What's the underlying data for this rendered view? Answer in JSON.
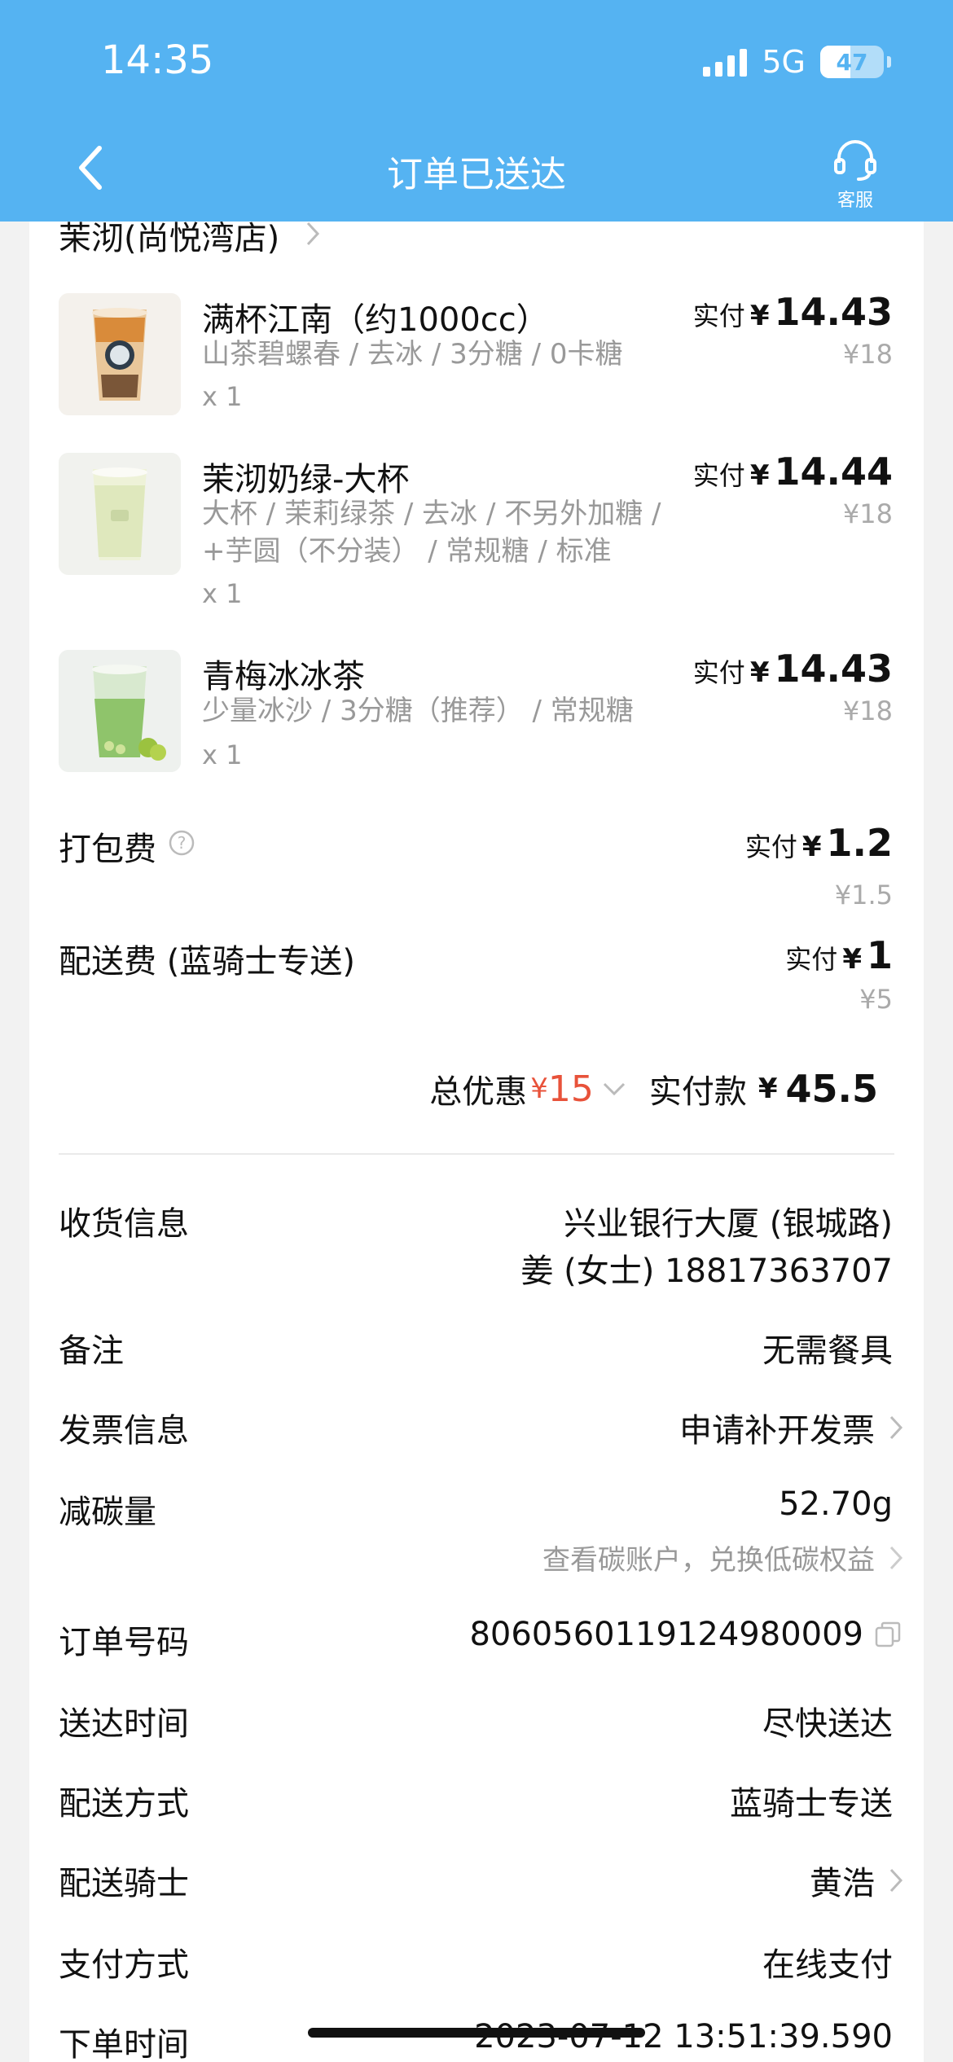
{
  "status_bar": {
    "time": "14:35",
    "network": "5G",
    "battery": "47",
    "battery_level": 0.47
  },
  "nav": {
    "back_icon": "chevron-left-icon",
    "title": "订单已送达",
    "service_label": "客服",
    "service_icon": "headset-icon"
  },
  "colors": {
    "header": "#55b3f2",
    "discount": "#e8523a",
    "muted": "#999999"
  },
  "store": {
    "name": "茉沏(尚悦湾店)"
  },
  "items": [
    {
      "name": "满杯江南（约1000cc）",
      "spec_lines": [
        "山茶碧螺春 / 去冰 / 3分糖 / 0卡糖"
      ],
      "qty": "x 1",
      "paid_label": "实付",
      "currency": "¥",
      "paid": "14.43",
      "original": "¥18"
    },
    {
      "name": "茉沏奶绿-大杯",
      "spec_lines": [
        "大杯 / 茉莉绿茶 / 去冰 / 不另外加糖 /",
        "+芋圆（不分装） / 常规糖 / 标准"
      ],
      "qty": "x 1",
      "paid_label": "实付",
      "currency": "¥",
      "paid": "14.44",
      "original": "¥18"
    },
    {
      "name": "青梅冰冰茶",
      "spec_lines": [
        "少量冰沙 / 3分糖（推荐） / 常规糖"
      ],
      "qty": "x 1",
      "paid_label": "实付",
      "currency": "¥",
      "paid": "14.43",
      "original": "¥18"
    }
  ],
  "fees": {
    "packaging": {
      "label": "打包费",
      "paid_label": "实付",
      "currency": "¥",
      "paid": "1.2",
      "original": "¥1.5"
    },
    "delivery": {
      "label": "配送费 (蓝骑士专送)",
      "paid_label": "实付",
      "currency": "¥",
      "paid": "1",
      "original": "¥5"
    }
  },
  "summary": {
    "discount_label": "总优惠",
    "discount_currency": "¥",
    "discount": "15",
    "total_label": "实付款",
    "total_currency": "¥",
    "total": "45.5"
  },
  "info": {
    "address": {
      "label": "收货信息",
      "line1": "兴业银行大厦 (银城路)",
      "line2": "姜 (女士) 18817363707"
    },
    "note": {
      "label": "备注",
      "value": "无需餐具"
    },
    "invoice": {
      "label": "发票信息",
      "value": "申请补开发票"
    },
    "carbon": {
      "label": "减碳量",
      "value": "52.70g",
      "sub": "查看碳账户，兑换低碳权益"
    },
    "order_no": {
      "label": "订单号码",
      "value": "8060560119124980009"
    },
    "delivery_time": {
      "label": "送达时间",
      "value": "尽快送达"
    },
    "delivery_method": {
      "label": "配送方式",
      "value": "蓝骑士专送"
    },
    "rider": {
      "label": "配送骑士",
      "value": "黄浩"
    },
    "payment": {
      "label": "支付方式",
      "value": "在线支付"
    },
    "order_time": {
      "label": "下单时间",
      "value": "2023-07-12 13:51:39.590"
    }
  }
}
